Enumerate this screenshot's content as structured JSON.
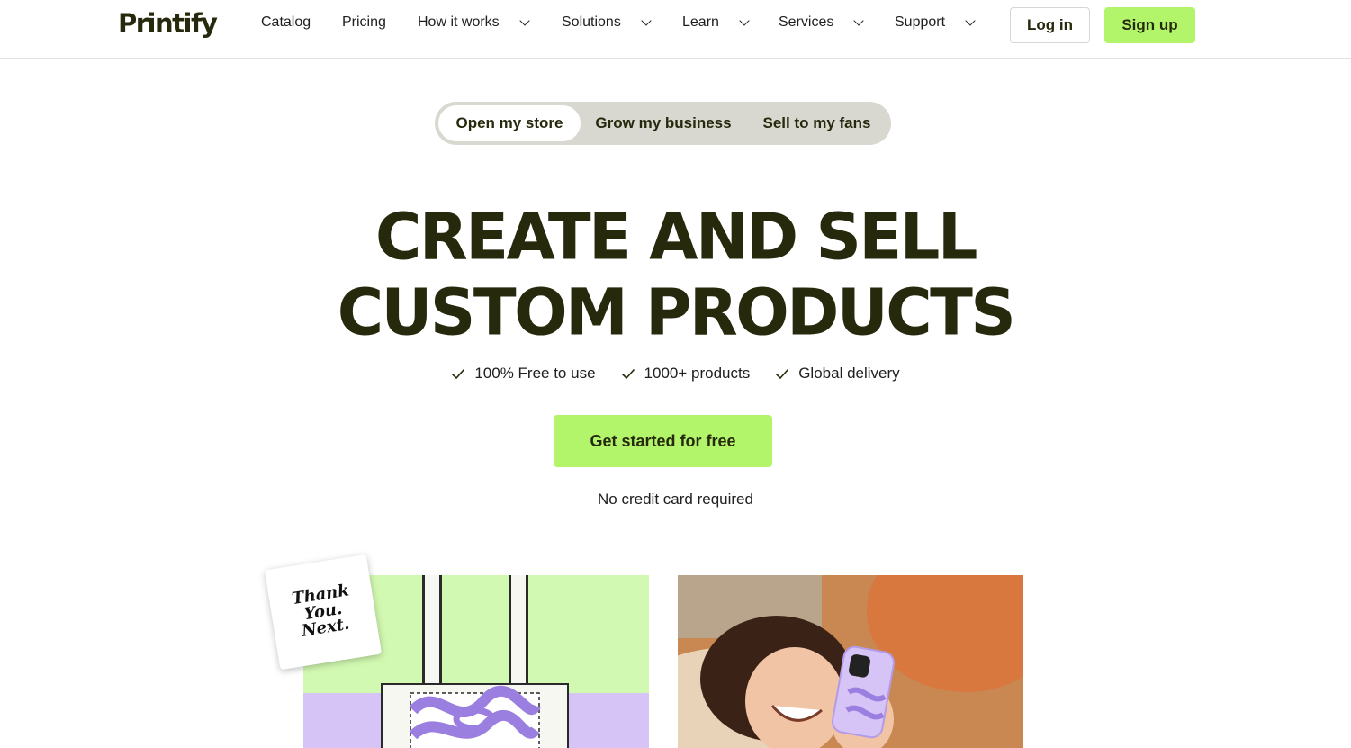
{
  "header": {
    "logo": "Printify",
    "nav": [
      {
        "label": "Catalog",
        "dropdown": false
      },
      {
        "label": "Pricing",
        "dropdown": false
      },
      {
        "label": "How it works",
        "dropdown": true
      },
      {
        "label": "Solutions",
        "dropdown": true
      },
      {
        "label": "Learn",
        "dropdown": true
      },
      {
        "label": "Services",
        "dropdown": true
      },
      {
        "label": "Support",
        "dropdown": true
      }
    ],
    "login": "Log in",
    "signup": "Sign up"
  },
  "tabs": [
    {
      "label": "Open my store",
      "active": true
    },
    {
      "label": "Grow my business",
      "active": false
    },
    {
      "label": "Sell to my fans",
      "active": false
    }
  ],
  "hero": {
    "title_line1": "CREATE AND SELL",
    "title_line2": "CUSTOM PRODUCTS",
    "features": [
      "100% Free to use",
      "1000+ products",
      "Global delivery"
    ],
    "cta": "Get started for free",
    "note": "No credit card required"
  },
  "sticker": {
    "line1": "Thank",
    "line2": "You.",
    "line3": "Next."
  },
  "colors": {
    "accent": "#b2f56a",
    "text_dark": "#27290d",
    "tab_bg": "#d8d8d0",
    "lavender": "#d5c4f5",
    "lime_light": "#d2f9b1"
  }
}
